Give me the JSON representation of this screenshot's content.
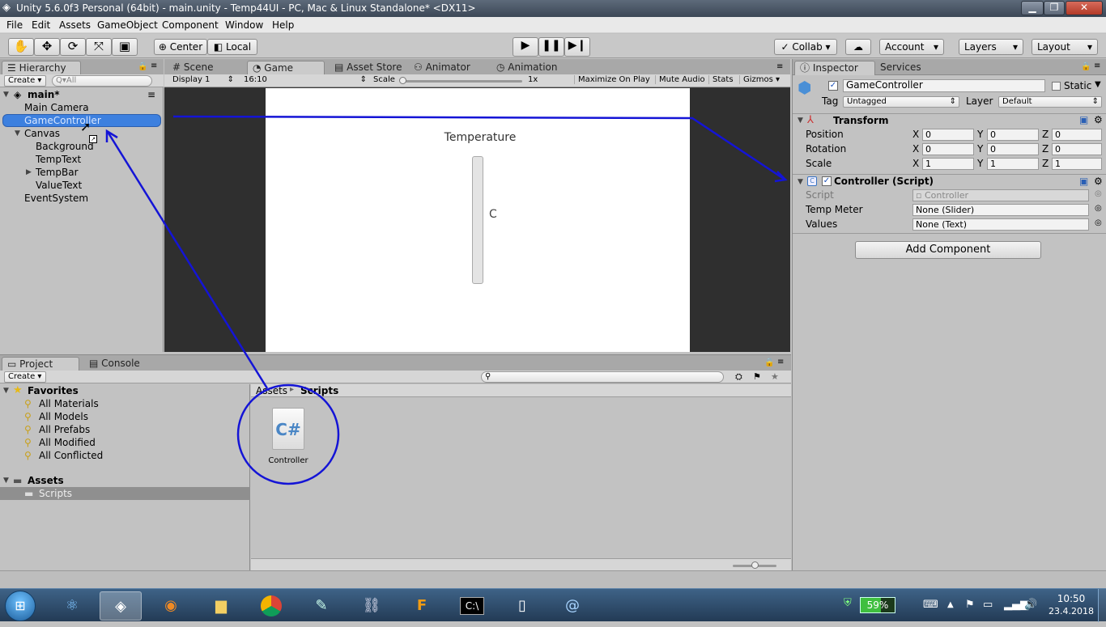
{
  "window": {
    "title": "Unity 5.6.0f3 Personal (64bit) - main.unity - Temp44UI - PC, Mac & Linux Standalone* <DX11>",
    "buttons": [
      "▁",
      "❐",
      "✕"
    ]
  },
  "menu": [
    "File",
    "Edit",
    "Assets",
    "GameObject",
    "Component",
    "Window",
    "Help"
  ],
  "toolbar": {
    "transform_tools": [
      "hand-icon",
      "move-icon",
      "rotate-icon",
      "scale-icon",
      "rect-icon"
    ],
    "pivot": "Center",
    "space": "Local",
    "collab": "Collab ▾",
    "account": "Account",
    "layers": "Layers",
    "layout": "Layout"
  },
  "hierarchy": {
    "tab": "Hierarchy",
    "create": "Create ▾",
    "search_placeholder": "Q▾All",
    "scene": "main*",
    "items": [
      "Main Camera",
      "GameController",
      "Canvas",
      "Background",
      "TempText",
      "TempBar",
      "ValueText",
      "EventSystem"
    ]
  },
  "center_tabs": [
    "Scene",
    "Game",
    "Asset Store",
    "Animator",
    "Animation"
  ],
  "game": {
    "display": "Display 1",
    "aspect": "16:10",
    "scale_label": "Scale",
    "scale_value": "1x",
    "maximize": "Maximize On Play",
    "mute": "Mute Audio",
    "stats": "Stats",
    "gizmos": "Gizmos ▾",
    "temp_title": "Temperature",
    "value_text": "C"
  },
  "inspector": {
    "tabs": [
      "Inspector",
      "Services"
    ],
    "object_name": "GameController",
    "static_label": "Static",
    "tag_label": "Tag",
    "tag_value": "Untagged",
    "layer_label": "Layer",
    "layer_value": "Default",
    "transform": {
      "title": "Transform",
      "rows": [
        {
          "label": "Position",
          "x": "0",
          "y": "0",
          "z": "0"
        },
        {
          "label": "Rotation",
          "x": "0",
          "y": "0",
          "z": "0"
        },
        {
          "label": "Scale",
          "x": "1",
          "y": "1",
          "z": "1"
        }
      ]
    },
    "script": {
      "title": "Controller (Script)",
      "script_label": "Script",
      "script_value": "Controller",
      "temp_meter_label": "Temp Meter",
      "temp_meter_value": "None (Slider)",
      "values_label": "Values",
      "values_value": "None (Text)"
    },
    "add_component": "Add Component"
  },
  "project": {
    "tabs": [
      "Project",
      "Console"
    ],
    "create": "Create ▾",
    "favorites_label": "Favorites",
    "favorites": [
      "All Materials",
      "All Models",
      "All Prefabs",
      "All Modified",
      "All Conflicted"
    ],
    "assets_label": "Assets",
    "folders": [
      "Scripts"
    ],
    "breadcrumb_root": "Assets",
    "breadcrumb_sep": "▸",
    "breadcrumb_current": "Scripts",
    "file_name": "Controller",
    "file_icon_text": "C#"
  },
  "taskbar": {
    "battery": "59%",
    "time": "10:50",
    "date": "23.4.2018"
  },
  "colors": {
    "annotation": "#1414d6",
    "selection": "#3d80df",
    "titlebar": "#4a5767"
  }
}
